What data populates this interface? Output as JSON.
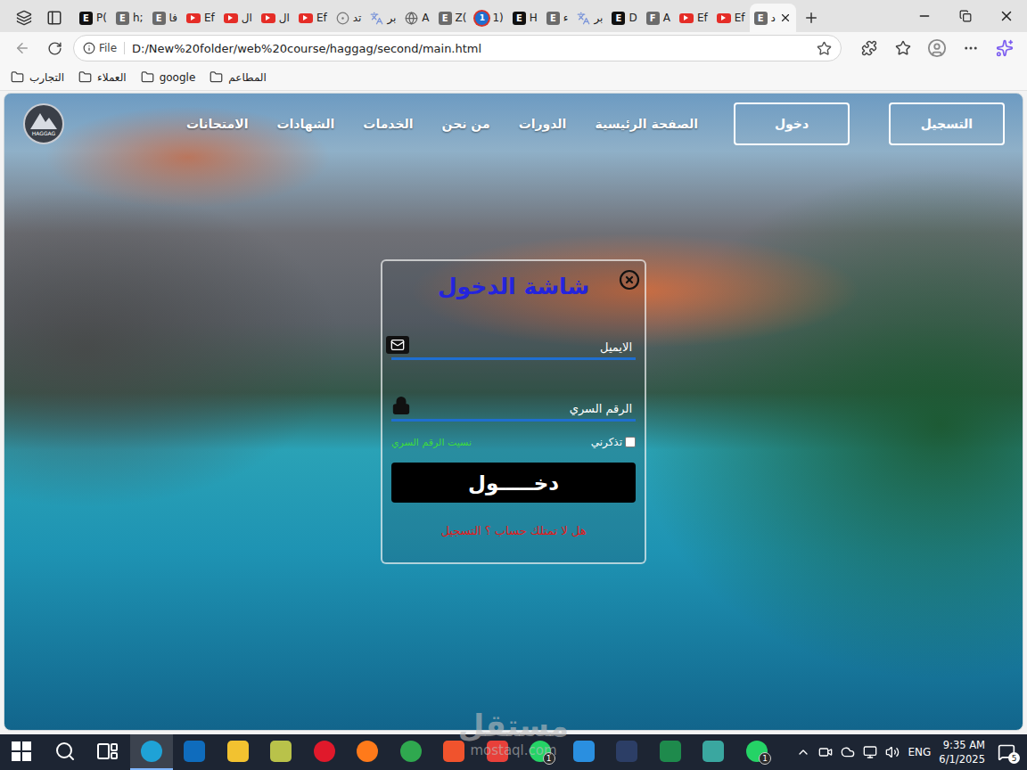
{
  "browser": {
    "tabs": [
      {
        "label": "P(",
        "kind": "letter",
        "glyph": "E",
        "color": "#111111",
        "selected": false
      },
      {
        "label": "h;",
        "kind": "letter",
        "glyph": "E",
        "color": "#6b6b6b",
        "selected": false
      },
      {
        "label": "فا",
        "kind": "letter",
        "glyph": "E",
        "color": "#6b6b6b",
        "selected": false
      },
      {
        "label": "Ef",
        "kind": "video",
        "glyph": "",
        "color": "#e52d27",
        "selected": false
      },
      {
        "label": "ال",
        "kind": "video",
        "glyph": "",
        "color": "#e52d27",
        "selected": false
      },
      {
        "label": "ال",
        "kind": "video",
        "glyph": "",
        "color": "#e52d27",
        "selected": false
      },
      {
        "label": "Ef",
        "kind": "video",
        "glyph": "",
        "color": "#e52d27",
        "selected": false
      },
      {
        "label": "تد",
        "kind": "circle",
        "glyph": "",
        "color": "#777777",
        "selected": false
      },
      {
        "label": "بر",
        "kind": "translate",
        "glyph": "",
        "color": "#7b95d9",
        "selected": false
      },
      {
        "label": "A",
        "kind": "globe",
        "glyph": "",
        "color": "#666666",
        "selected": false
      },
      {
        "label": "Z(",
        "kind": "letter",
        "glyph": "E",
        "color": "#6b6b6b",
        "selected": false
      },
      {
        "label": "1)",
        "kind": "counter",
        "glyph": "1",
        "color": "#1f6fd1",
        "selected": false
      },
      {
        "label": "H",
        "kind": "letter",
        "glyph": "E",
        "color": "#111111",
        "selected": false
      },
      {
        "label": "ء",
        "kind": "letter",
        "glyph": "E",
        "color": "#6b6b6b",
        "selected": false
      },
      {
        "label": "بر",
        "kind": "translate",
        "glyph": "",
        "color": "#7b95d9",
        "selected": false
      },
      {
        "label": "D",
        "kind": "letter",
        "glyph": "E",
        "color": "#111111",
        "selected": false
      },
      {
        "label": "A",
        "kind": "letter",
        "glyph": "F",
        "color": "#6b6b6b",
        "selected": false
      },
      {
        "label": "Ef",
        "kind": "video",
        "glyph": "",
        "color": "#e52d27",
        "selected": false
      },
      {
        "label": "Ef",
        "kind": "video",
        "glyph": "",
        "color": "#e52d27",
        "selected": false
      },
      {
        "label": "د",
        "kind": "letter",
        "glyph": "E",
        "color": "#6b6b6b",
        "selected": true
      }
    ],
    "address": {
      "scheme": "File",
      "url": "D:/New%20folder/web%20course/haggag/second/main.html"
    },
    "bookmarks": [
      {
        "label": "التجارب"
      },
      {
        "label": "العملاء"
      },
      {
        "label": "google"
      },
      {
        "label": "المطاعم"
      }
    ]
  },
  "page": {
    "logo": {
      "text": "HAGGAG"
    },
    "buttons": [
      {
        "label": "التسجيل"
      },
      {
        "label": "دخول"
      }
    ],
    "nav_links": [
      {
        "label": "الصفحة الرئيسية"
      },
      {
        "label": "الدورات"
      },
      {
        "label": "من نحن"
      },
      {
        "label": "الخدمات"
      },
      {
        "label": "الشهادات"
      },
      {
        "label": "الامتحانات"
      }
    ],
    "modal": {
      "title": "شاشة الدخول",
      "fields": [
        {
          "label": "الايميل",
          "kind": "email"
        },
        {
          "label": "الرقم السري",
          "kind": "password"
        }
      ],
      "remember": {
        "label": "تذكرني",
        "checked": false
      },
      "forgot": "نسيت الرقم السري",
      "submit": "دخـــــول",
      "signup": "هل لا تمتلك حساب ؟ التسجيل"
    }
  },
  "taskbar": {
    "apps": [
      {
        "kind": "windows",
        "color": "#ffffff",
        "selected": false,
        "badge": ""
      },
      {
        "kind": "search",
        "color": "#ffffff",
        "selected": false,
        "badge": ""
      },
      {
        "kind": "taskview",
        "color": "#ffffff",
        "selected": false,
        "badge": ""
      },
      {
        "kind": "circle",
        "color": "#1fa2d6",
        "selected": true,
        "badge": ""
      },
      {
        "kind": "square",
        "color": "#0f6cbd",
        "selected": false,
        "badge": ""
      },
      {
        "kind": "square",
        "color": "#f2c230",
        "selected": false,
        "badge": ""
      },
      {
        "kind": "square",
        "color": "#b9c24a",
        "selected": false,
        "badge": ""
      },
      {
        "kind": "circle",
        "color": "#e0192b",
        "selected": false,
        "badge": ""
      },
      {
        "kind": "circle",
        "color": "#ff7a1a",
        "selected": false,
        "badge": ""
      },
      {
        "kind": "circle",
        "color": "#2fa84f",
        "selected": false,
        "badge": ""
      },
      {
        "kind": "square",
        "color": "#f0532d",
        "selected": false,
        "badge": ""
      },
      {
        "kind": "square",
        "color": "#e8403a",
        "selected": false,
        "badge": ""
      },
      {
        "kind": "circle",
        "color": "#25d366",
        "selected": false,
        "badge": "1"
      },
      {
        "kind": "square",
        "color": "#2a8fe0",
        "selected": false,
        "badge": ""
      },
      {
        "kind": "square",
        "color": "#2c3e66",
        "selected": false,
        "badge": ""
      },
      {
        "kind": "square",
        "color": "#1e8a4c",
        "selected": false,
        "badge": ""
      },
      {
        "kind": "square",
        "color": "#3aa7a0",
        "selected": false,
        "badge": ""
      },
      {
        "kind": "circle",
        "color": "#25d366",
        "selected": false,
        "badge": "1"
      }
    ],
    "tray": {
      "language": "ENG",
      "time": "9:35 AM",
      "date": "6/1/2025",
      "notifications": "5"
    }
  },
  "watermark": {
    "arabic": "مستقل",
    "latin": "mostaql.com"
  }
}
